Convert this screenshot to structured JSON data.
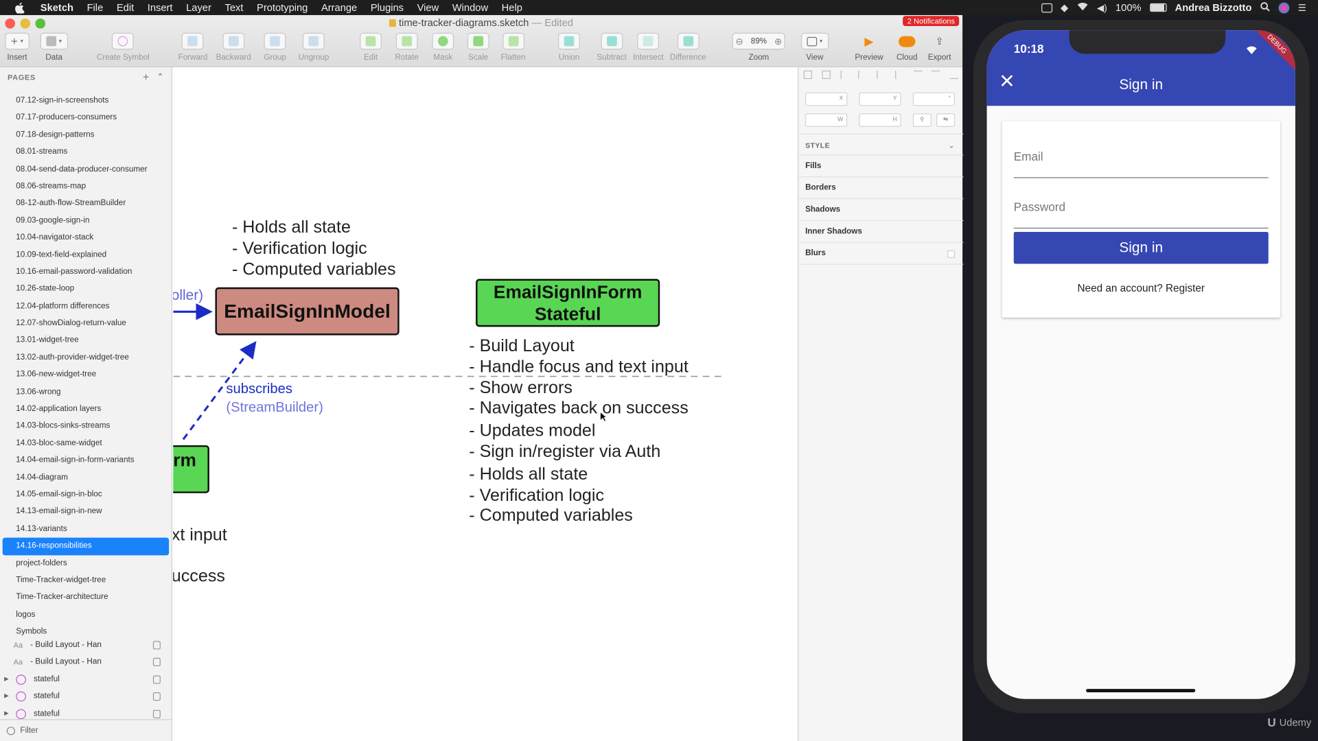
{
  "menubar": {
    "items": [
      "Sketch",
      "File",
      "Edit",
      "Insert",
      "Layer",
      "Text",
      "Prototyping",
      "Arrange",
      "Plugins",
      "View",
      "Window",
      "Help"
    ],
    "battery": "100%",
    "user": "Andrea Bizzotto"
  },
  "window": {
    "title": "time-tracker-diagrams.sketch",
    "edited": "— Edited",
    "notifications": "2 Notifications"
  },
  "toolbar": {
    "insert": "Insert",
    "data": "Data",
    "create_symbol": "Create Symbol",
    "forward": "Forward",
    "backward": "Backward",
    "group": "Group",
    "ungroup": "Ungroup",
    "edit": "Edit",
    "rotate": "Rotate",
    "mask": "Mask",
    "scale": "Scale",
    "flatten": "Flatten",
    "union": "Union",
    "subtract": "Subtract",
    "intersect": "Intersect",
    "difference": "Difference",
    "zoom": "Zoom",
    "zoom_value": "89%",
    "view": "View",
    "preview": "Preview",
    "cloud": "Cloud",
    "export": "Export"
  },
  "sidebar": {
    "heading": "PAGES",
    "pages": [
      "07.12-sign-in-screenshots",
      "07.17-producers-consumers",
      "07.18-design-patterns",
      "08.01-streams",
      "08.04-send-data-producer-consumer",
      "08.06-streams-map",
      "08-12-auth-flow-StreamBuilder",
      "09.03-google-sign-in",
      "10.04-navigator-stack",
      "10.09-text-field-explained",
      "10.16-email-password-validation",
      "10.26-state-loop",
      "12.04-platform differences",
      "12.07-showDialog-return-value",
      "13.01-widget-tree",
      "13.02-auth-provider-widget-tree",
      "13.06-new-widget-tree",
      "13.06-wrong",
      "14.02-application layers",
      "14.03-blocs-sinks-streams",
      "14.03-bloc-same-widget",
      "14.04-email-sign-in-form-variants",
      "14.04-diagram",
      "14.05-email-sign-in-bloc",
      "14.13-email-sign-in-new",
      "14.13-variants",
      "14.16-responsibilities",
      "project-folders",
      "Time-Tracker-widget-tree",
      "Time-Tracker-architecture",
      "logos",
      "Symbols"
    ],
    "selected_page": "14.16-responsibilities",
    "layers": [
      {
        "type": "text",
        "prefix": "Aa",
        "label": "- Build Layout - Han"
      },
      {
        "type": "text",
        "prefix": "Aa",
        "label": "- Build Layout - Han"
      },
      {
        "type": "symbol",
        "label": "stateful"
      },
      {
        "type": "symbol",
        "label": "stateful"
      },
      {
        "type": "symbol",
        "label": "stateful"
      }
    ],
    "filter": "Filter"
  },
  "canvas": {
    "model_bullets": [
      "- Holds all state",
      "- Verification logic",
      "- Computed variables"
    ],
    "model_box": "EmailSignInModel",
    "controller_fragment": "oller)",
    "form_stateful_line1": "EmailSignInForm",
    "form_stateful_line2": "Stateful",
    "subscribes": "subscribes",
    "streambuilder": "(StreamBuilder)",
    "form_fragment": "rm",
    "text_input_fragment": "xt input",
    "success_fragment": "uccess",
    "stateful_bullets": [
      "- Build Layout",
      "- Handle focus and text input",
      "- Show errors",
      "- Navigates back on success",
      "- Updates model",
      "- Sign in/register via Auth",
      "- Holds all state",
      "- Verification logic",
      "- Computed variables"
    ],
    "colors": {
      "model_box": "#cd8a80",
      "green_box": "#59d653",
      "arrow": "#1c2cc4"
    }
  },
  "inspector": {
    "x": "X",
    "y": "Y",
    "w": "W",
    "h": "H",
    "style": "STYLE",
    "sections": [
      "Fills",
      "Borders",
      "Shadows",
      "Inner Shadows",
      "Blurs"
    ]
  },
  "phone": {
    "time": "10:18",
    "debug": "DEBUG",
    "title": "Sign in",
    "email_placeholder": "Email",
    "password_placeholder": "Password",
    "sign_in_button": "Sign in",
    "register_link": "Need an account? Register",
    "colors": {
      "primary": "#3547b3"
    }
  },
  "watermark": "Udemy"
}
